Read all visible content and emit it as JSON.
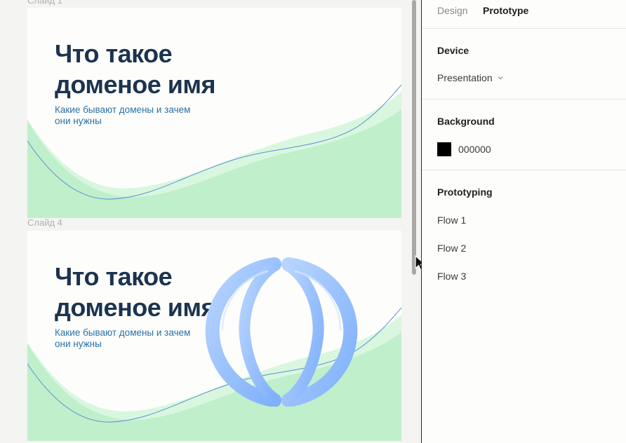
{
  "canvas": {
    "slides": [
      {
        "label": "Слайд 1",
        "title_line1": "Что такое",
        "title_line2": "доменое имя",
        "subtitle_line1": "Какие бывают домены и зачем",
        "subtitle_line2": "они нужны",
        "has_globe": false
      },
      {
        "label": "Слайд 4",
        "title_line1": "Что такое",
        "title_line2": "доменое имя",
        "subtitle_line1": "Какие бывают домены и зачем",
        "subtitle_line2": "они нужны",
        "has_globe": true
      }
    ]
  },
  "panel": {
    "tabs": [
      {
        "label": "Design",
        "active": false
      },
      {
        "label": "Prototype",
        "active": true
      }
    ],
    "device": {
      "title": "Device",
      "value": "Presentation"
    },
    "background": {
      "title": "Background",
      "color_hex": "000000"
    },
    "prototyping": {
      "title": "Prototyping",
      "flows": [
        "Flow 1",
        "Flow 2",
        "Flow 3"
      ]
    }
  },
  "colors": {
    "title": "#1c3350",
    "subtitle": "#2a6fa8",
    "wave_light": "#d9f7df",
    "wave_main": "#c0efcb",
    "line": "#5b8fd6",
    "globe": "#9cc3ff"
  },
  "icons": {
    "dropdown": "chevron-down-icon",
    "cursor": "cursor-arrow-icon",
    "globe": "globe-3d-icon"
  }
}
